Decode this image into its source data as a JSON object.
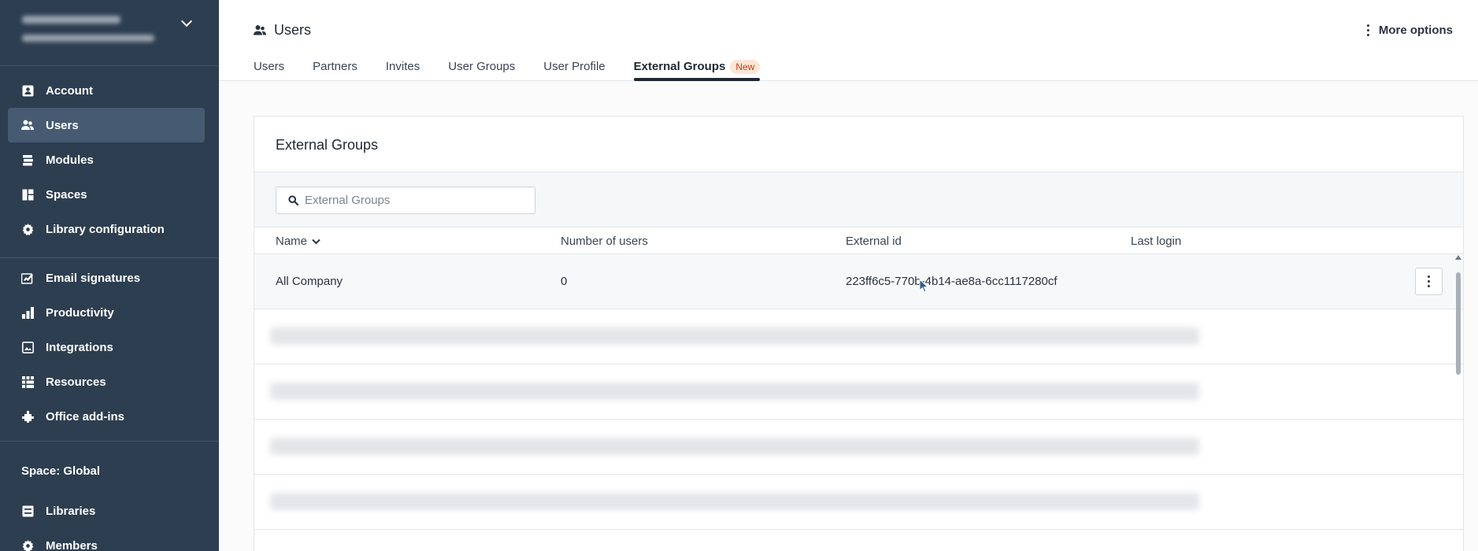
{
  "sidebar": {
    "nav_items": [
      {
        "label": "Account",
        "icon": "account-icon"
      },
      {
        "label": "Users",
        "icon": "users-icon",
        "active": true
      },
      {
        "label": "Modules",
        "icon": "modules-icon"
      },
      {
        "label": "Spaces",
        "icon": "spaces-icon"
      },
      {
        "label": "Library configuration",
        "icon": "gear-icon"
      },
      {
        "label": "Email signatures",
        "icon": "signature-icon"
      },
      {
        "label": "Productivity",
        "icon": "productivity-icon"
      },
      {
        "label": "Integrations",
        "icon": "integrations-icon"
      },
      {
        "label": "Resources",
        "icon": "resources-icon"
      },
      {
        "label": "Office add-ins",
        "icon": "plugin-icon"
      }
    ],
    "space_label": "Space: Global",
    "space_items": [
      {
        "label": "Libraries",
        "icon": "libraries-icon"
      },
      {
        "label": "Members",
        "icon": "gear-icon"
      }
    ]
  },
  "header": {
    "title": "Users",
    "more_options": "More options",
    "tabs": [
      {
        "label": "Users"
      },
      {
        "label": "Partners"
      },
      {
        "label": "Invites"
      },
      {
        "label": "User Groups"
      },
      {
        "label": "User Profile"
      },
      {
        "label": "External Groups",
        "badge": "New",
        "active": true
      }
    ]
  },
  "card": {
    "title": "External Groups",
    "search_placeholder": "External Groups",
    "columns": [
      "Name",
      "Number of users",
      "External id",
      "Last login"
    ],
    "rows": [
      {
        "name": "All Company",
        "users": "0",
        "external_id": "223ff6c5-770b-4b14-ae8a-6cc1117280cf",
        "last_login": ""
      }
    ]
  },
  "colors": {
    "sidebar_bg": "#2d3e50",
    "sidebar_active": "#465a72",
    "badge_bg": "#fde5d7",
    "badge_text": "#c2410c"
  }
}
